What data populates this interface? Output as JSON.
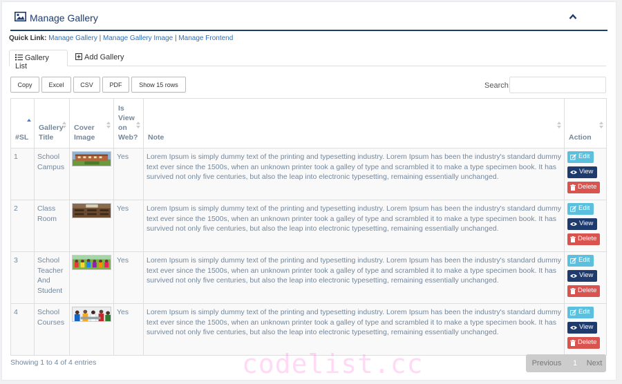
{
  "header": {
    "title": "Manage Gallery",
    "icon": "image-icon",
    "collapse_icon": "chevron-up-icon"
  },
  "quick_links": {
    "label": "Quick Link:",
    "links": [
      "Manage Gallery",
      "Manage Gallery Image",
      "Manage Frontend"
    ],
    "separator": "|"
  },
  "tabs": [
    {
      "label": "Gallery List",
      "icon": "list-icon",
      "active": true
    },
    {
      "label": "Add Gallery",
      "icon": "plus-square-icon",
      "active": false
    }
  ],
  "toolbar": {
    "buttons": [
      "Copy",
      "Excel",
      "CSV",
      "PDF",
      "Show 15 rows"
    ],
    "search_label": "Search:",
    "search_value": ""
  },
  "table": {
    "columns": [
      "#SL",
      "Gallery Title",
      "Cover Image",
      "Is View on Web?",
      "Note",
      "Action"
    ],
    "rows": [
      {
        "sl": "1",
        "title": "School Campus",
        "image": "school-campus-thumbnail",
        "web": "Yes",
        "note": "Lorem Ipsum is simply dummy text of the printing and typesetting industry. Lorem Ipsum has been the industry's standard dummy text ever since the 1500s, when an unknown printer took a galley of type and scrambled it to make a type specimen book. It has survived not only five centuries, but also the leap into electronic typesetting, remaining essentially unchanged."
      },
      {
        "sl": "2",
        "title": "Class Room",
        "image": "classroom-thumbnail",
        "web": "Yes",
        "note": "Lorem Ipsum is simply dummy text of the printing and typesetting industry. Lorem Ipsum has been the industry's standard dummy text ever since the 1500s, when an unknown printer took a galley of type and scrambled it to make a type specimen book. It has survived not only five centuries, but also the leap into electronic typesetting, remaining essentially unchanged."
      },
      {
        "sl": "3",
        "title": "School Teacher And Student",
        "image": "teacher-students-thumbnail",
        "web": "Yes",
        "note": "Lorem Ipsum is simply dummy text of the printing and typesetting industry. Lorem Ipsum has been the industry's standard dummy text ever since the 1500s, when an unknown printer took a galley of type and scrambled it to make a type specimen book. It has survived not only five centuries, but also the leap into electronic typesetting, remaining essentially unchanged."
      },
      {
        "sl": "4",
        "title": "School Courses",
        "image": "courses-thumbnail",
        "web": "Yes",
        "note": "Lorem Ipsum is simply dummy text of the printing and typesetting industry. Lorem Ipsum has been the industry's standard dummy text ever since the 1500s, when an unknown printer took a galley of type and scrambled it to make a type specimen book. It has survived not only five centuries, but also the leap into electronic typesetting, remaining essentially unchanged."
      }
    ],
    "actions": {
      "edit": "Edit",
      "view": "View",
      "delete": "Delete"
    }
  },
  "footer": {
    "info": "Showing 1 to 4 of 4 entries",
    "pager": {
      "previous": "Previous",
      "page": "1",
      "next": "Next"
    }
  },
  "watermark": "codelist.cc",
  "colors": {
    "primary": "#1f3b6e",
    "edit": "#5bc0de",
    "view": "#1f3b6e",
    "delete": "#d9534f",
    "link": "#2a6ebd"
  }
}
